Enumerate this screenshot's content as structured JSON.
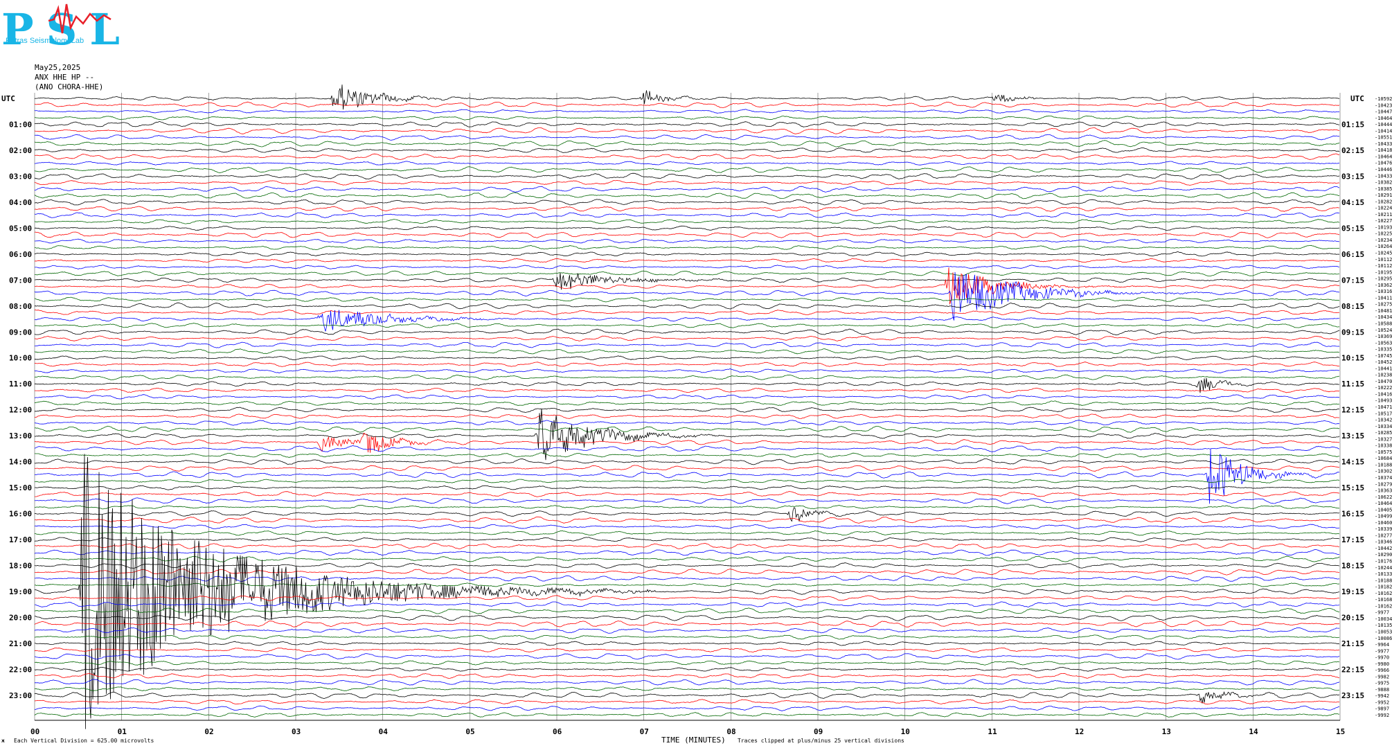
{
  "header": {
    "logo_letters": "PSL",
    "logo_subtitle": "Patras Seismology Lab",
    "date": "May25,2025",
    "station": "ANX HHE HP --",
    "station_name": "(ANO CHORA-HHE)"
  },
  "left_axis": {
    "tz_label": "UTC",
    "hour_labels": [
      "01:00",
      "02:00",
      "03:00",
      "04:00",
      "05:00",
      "06:00",
      "07:00",
      "08:00",
      "09:00",
      "10:00",
      "11:00",
      "12:00",
      "13:00",
      "14:00",
      "15:00",
      "16:00",
      "17:00",
      "18:00",
      "19:00",
      "20:00",
      "21:00",
      "22:00",
      "23:00"
    ]
  },
  "right_axis": {
    "tz_label": "UTC",
    "hour_labels": [
      "01:15",
      "02:15",
      "03:15",
      "04:15",
      "05:15",
      "06:15",
      "07:15",
      "08:15",
      "09:15",
      "10:15",
      "11:15",
      "12:15",
      "13:15",
      "14:15",
      "15:15",
      "16:15",
      "17:15",
      "18:15",
      "19:15",
      "20:15",
      "21:15",
      "22:15",
      "23:15"
    ],
    "offsets": [
      "-10592",
      "-10423",
      "-10447",
      "-10464",
      "-10444",
      "-10414",
      "-10551",
      "-10433",
      "-10418",
      "-10464",
      "-10476",
      "-10446",
      "-10433",
      "-10382",
      "-10385",
      "-10291",
      "-10282",
      "-10224",
      "-10211",
      "-10227",
      "-10193",
      "-10225",
      "-10234",
      "-10264",
      "-10245",
      "-10112",
      "-10112",
      "-10195",
      "-10295",
      "-10362",
      "-10316",
      "-10411",
      "-10275",
      "-10481",
      "-10434",
      "-10588",
      "-10524",
      "-10369",
      "-10563",
      "-10335",
      "-10745",
      "-10452",
      "-10441",
      "-10238",
      "-10470",
      "-10222",
      "-10416",
      "-10493",
      "-10471",
      "-10517",
      "-10342",
      "-10334",
      "-10285",
      "-10327",
      "-10338",
      "-10575",
      "-10684",
      "-10188",
      "-10302",
      "-10374",
      "-10279",
      "-10363",
      "-10622",
      "-10464",
      "-10405",
      "-10499",
      "-10460",
      "-10339",
      "-10277",
      "-10346",
      "-10442",
      "-10290",
      "-10176",
      "-10244",
      "-10133",
      "-10188",
      "-10182",
      "-10162",
      "-10168",
      "-10162",
      "-9977",
      "-10034",
      "-10135",
      "-10053",
      "-10086",
      "-9964",
      "-9977",
      "-9970",
      "-9980",
      "-9966",
      "-9982",
      "-9975",
      "-9888",
      "-9942",
      "-9952",
      "-9897",
      "-9992"
    ]
  },
  "x_axis": {
    "title": "TIME (MINUTES)",
    "tick_labels": [
      "00",
      "01",
      "02",
      "03",
      "04",
      "05",
      "06",
      "07",
      "08",
      "09",
      "10",
      "11",
      "12",
      "13",
      "14",
      "15"
    ]
  },
  "footer": {
    "left_mark": "ж",
    "scale_note": "Each Vertical Division =  625.00 microvolts",
    "clip_note": "Traces clipped at plus/minus 25 vertical divisions"
  },
  "colors": {
    "trace_cycle": [
      "#000000",
      "#ff0000",
      "#0000ff",
      "#006600"
    ],
    "grid": "#777777",
    "logo_cyan": "#19b5e6",
    "logo_red": "#e8202a"
  },
  "chart_data": {
    "type": "helicorder",
    "title": "",
    "xlabel": "TIME (MINUTES)",
    "ylabel": "UTC",
    "xlim": [
      0,
      15
    ],
    "minutes_per_line": 15,
    "lines": 96,
    "start_utc": "00:00",
    "units": "microvolts",
    "vertical_division_microvolts": 625.0,
    "clip_divisions": 25,
    "events": [
      {
        "line": 0,
        "minute": 3.45,
        "amplitude": 2.8,
        "duration": 0.6
      },
      {
        "line": 0,
        "minute": 7.0,
        "amplitude": 1.4,
        "duration": 0.3
      },
      {
        "line": 0,
        "minute": 11.05,
        "amplitude": 1.2,
        "duration": 0.3
      },
      {
        "line": 29,
        "minute": 10.5,
        "amplitude": 3.5,
        "duration": 0.8
      },
      {
        "line": 30,
        "minute": 10.55,
        "amplitude": 5.0,
        "duration": 1.0
      },
      {
        "line": 34,
        "minute": 3.3,
        "amplitude": 2.2,
        "duration": 1.0
      },
      {
        "line": 28,
        "minute": 6.0,
        "amplitude": 1.8,
        "duration": 0.9
      },
      {
        "line": 52,
        "minute": 5.8,
        "amplitude": 5.5,
        "duration": 0.8
      },
      {
        "line": 53,
        "minute": 3.3,
        "amplitude": 1.8,
        "duration": 0.4
      },
      {
        "line": 53,
        "minute": 3.8,
        "amplitude": 2.4,
        "duration": 0.4
      },
      {
        "line": 58,
        "minute": 13.5,
        "amplitude": 6.0,
        "duration": 0.5
      },
      {
        "line": 64,
        "minute": 8.7,
        "amplitude": 1.6,
        "duration": 0.3
      },
      {
        "line": 44,
        "minute": 13.4,
        "amplitude": 1.8,
        "duration": 0.3
      },
      {
        "line": 92,
        "minute": 13.4,
        "amplitude": 1.4,
        "duration": 0.4
      },
      {
        "line": 76,
        "minute": 0.55,
        "amplitude": 25.0,
        "duration": 2.2
      }
    ]
  }
}
